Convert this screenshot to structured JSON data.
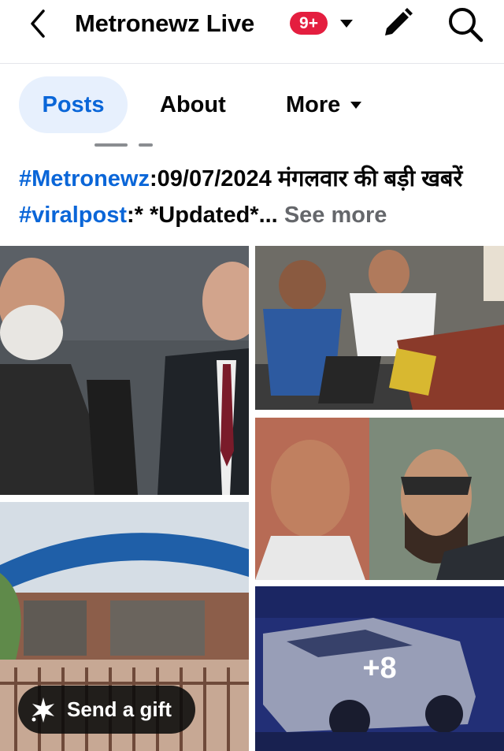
{
  "header": {
    "title": "Metronewz Live",
    "badge": "9+",
    "back_icon": "chevron-left-icon",
    "caret_icon": "caret-down-icon",
    "edit_icon": "pencil-icon",
    "search_icon": "search-icon"
  },
  "tabs": [
    {
      "label": "Posts",
      "active": true
    },
    {
      "label": "About",
      "active": false
    },
    {
      "label": "More",
      "active": false
    }
  ],
  "post": {
    "hashtag1": "#Metronewz",
    "text1": ":09/07/2024 मंगलवार की बड़ी खबरें ",
    "hashtag2": "#viralpost",
    "text2": ":* *Updated*...",
    "see_more": "See more"
  },
  "media": {
    "extra_count": "+8"
  },
  "gift_button": {
    "label": "Send a gift",
    "icon": "gift-sparkle-icon"
  },
  "colors": {
    "accent": "#0a66d8",
    "badge": "#e41e3f",
    "active_tab_bg": "#e7f0fd",
    "muted": "#65676b"
  }
}
